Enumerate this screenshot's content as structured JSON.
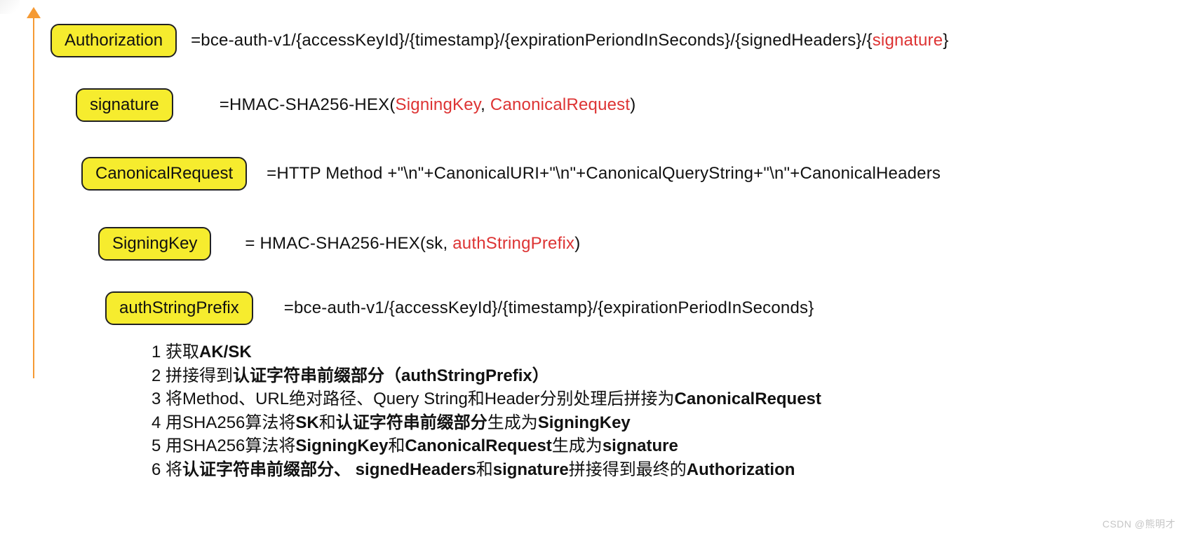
{
  "colors": {
    "chip_bg": "#f6ec2e",
    "arrow": "#f59a34",
    "red": "#d33"
  },
  "rows": [
    {
      "label": "Authorization",
      "segments": [
        {
          "t": "=bce-auth-v1/{accessKeyId}/{timestamp}/{expirationPeriondInSeconds}/{signedHeaders}/{"
        },
        {
          "t": "signature",
          "red": true
        },
        {
          "t": "}"
        }
      ]
    },
    {
      "label": "signature",
      "segments": [
        {
          "t": "=HMAC-SHA256-HEX("
        },
        {
          "t": "SigningKey",
          "red": true
        },
        {
          "t": ", "
        },
        {
          "t": "CanonicalRequest",
          "red": true
        },
        {
          "t": ")"
        }
      ]
    },
    {
      "label": "CanonicalRequest",
      "segments": [
        {
          "t": "=HTTP Method +\"\\n\"+CanonicalURI+\"\\n\"+CanonicalQueryString+\"\\n\"+CanonicalHeaders"
        }
      ]
    },
    {
      "label": "SigningKey",
      "segments": [
        {
          "t": "= HMAC-SHA256-HEX(sk, "
        },
        {
          "t": "authStringPrefix",
          "red": true
        },
        {
          "t": ")"
        }
      ]
    },
    {
      "label": "authStringPrefix",
      "segments": [
        {
          "t": "=bce-auth-v1/{accessKeyId}/{timestamp}/{expirationPeriodInSeconds}"
        }
      ]
    }
  ],
  "steps": [
    [
      {
        "t": "1 获取"
      },
      {
        "t": "AK/SK",
        "b": true
      }
    ],
    [
      {
        "t": "2 拼接得到"
      },
      {
        "t": "认证字符串前缀部分（authStringPrefix）",
        "b": true
      }
    ],
    [
      {
        "t": "3 将Method、URL绝对路径、Query String和Header分别处理后拼接为"
      },
      {
        "t": "CanonicalRequest",
        "b": true
      }
    ],
    [
      {
        "t": "4 用SHA256算法将"
      },
      {
        "t": "SK",
        "b": true
      },
      {
        "t": "和"
      },
      {
        "t": "认证字符串前缀部分",
        "b": true
      },
      {
        "t": "生成为"
      },
      {
        "t": "SigningKey",
        "b": true
      }
    ],
    [
      {
        "t": "5 用SHA256算法将"
      },
      {
        "t": "SigningKey",
        "b": true
      },
      {
        "t": "和"
      },
      {
        "t": "CanonicalRequest",
        "b": true
      },
      {
        "t": "生成为"
      },
      {
        "t": "signature",
        "b": true
      }
    ],
    [
      {
        "t": "6 将"
      },
      {
        "t": "认证字符串前缀部分、 signedHeaders",
        "b": true
      },
      {
        "t": "和"
      },
      {
        "t": "signature",
        "b": true
      },
      {
        "t": "拼接得到最终的"
      },
      {
        "t": "Authorization",
        "b": true
      }
    ]
  ],
  "watermark": "CSDN @熊明才"
}
